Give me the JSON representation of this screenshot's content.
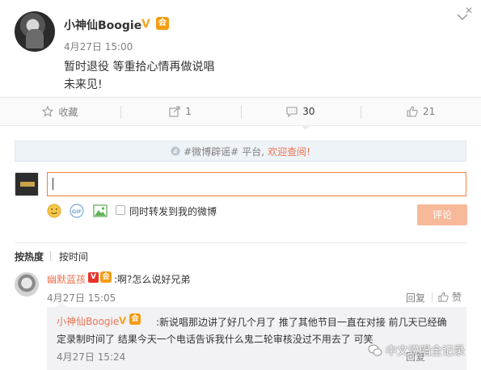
{
  "post": {
    "author": "小神仙Boogie",
    "verified_mark": "V",
    "vip_badge": "会",
    "time": "4月27日 15:00",
    "lines": [
      "暂时退役 等重拾心情再做说唱",
      "未来见!"
    ]
  },
  "actions": {
    "favorite_label": "收藏",
    "repost_count": "1",
    "comment_count": "30",
    "like_count": "21"
  },
  "notice": {
    "tag": "#微博辟谣#",
    "middle": "平台,",
    "link": "欢迎查阅!"
  },
  "composer": {
    "input_value": "",
    "gif_label": "GIF",
    "repost_label": "同时转发到我的微博",
    "submit_label": "评论"
  },
  "sort": {
    "hot": "按热度",
    "time": "按时间"
  },
  "comment": {
    "name": "幽默蓝孩",
    "v_mark": "V",
    "vip_badge": "会",
    "text": ":啊?怎么说好兄弟",
    "time": "4月27日 15:05",
    "reply_label": "回复",
    "like_label": "赞"
  },
  "reply": {
    "name": "小神仙Boogie",
    "v_mark": "V",
    "vip_badge": "会",
    "text": ":新说唱那边讲了好几个月了 推了其他节目一直在对接 前几天已经确定录制时间了 结果今天一个电话告诉我什么鬼二轮审核没过不用去了 可笑",
    "time": "4月27日 15:24",
    "reply_label": "回复"
  },
  "watermark": {
    "text": "中文说唱全记录"
  },
  "colors": {
    "accent": "#eb7350",
    "verified": "#f5a623",
    "input_border": "#fa7d3c"
  }
}
